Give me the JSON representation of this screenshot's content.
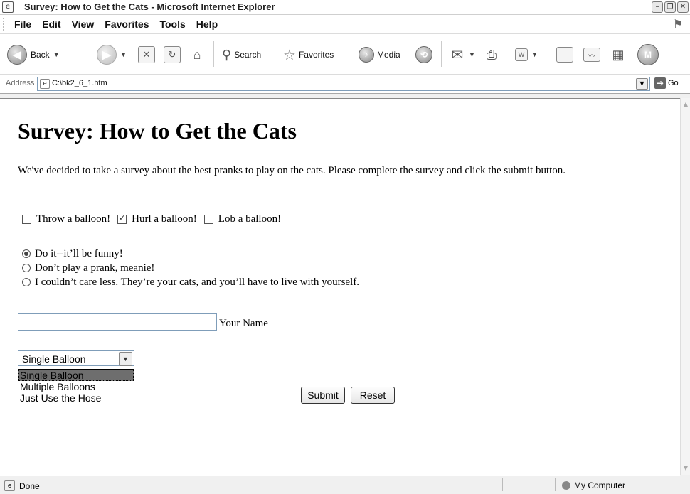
{
  "window": {
    "title": "Survey: How to Get the Cats - Microsoft Internet Explorer"
  },
  "menu": {
    "items": [
      "File",
      "Edit",
      "View",
      "Favorites",
      "Tools",
      "Help"
    ]
  },
  "toolbar": {
    "back_label": "Back",
    "search_label": "Search",
    "favorites_label": "Favorites",
    "media_label": "Media"
  },
  "address": {
    "label": "Address",
    "url": "C:\\bk2_6_1.htm",
    "go_label": "Go"
  },
  "page": {
    "title": "Survey: How to Get the Cats",
    "intro": "We've decided to take a survey about the best pranks to play on the cats. Please complete the survey and click the submit button.",
    "checkboxes": [
      {
        "label": "Throw a balloon!",
        "checked": false
      },
      {
        "label": "Hurl a balloon!",
        "checked": true
      },
      {
        "label": "Lob a balloon!",
        "checked": false
      }
    ],
    "radios": [
      {
        "label": "Do it--it’ll be funny!",
        "selected": true
      },
      {
        "label": "Don’t play a prank, meanie!",
        "selected": false
      },
      {
        "label": "I couldn’t care less. They’re your cats, and you’ll have to live with yourself.",
        "selected": false
      }
    ],
    "name_input": {
      "value": "",
      "label": "Your Name"
    },
    "select": {
      "value": "Single Balloon",
      "options": [
        "Single Balloon",
        "Multiple Balloons",
        "Just Use the Hose"
      ]
    },
    "submit_label": "Submit",
    "reset_label": "Reset"
  },
  "status": {
    "text": "Done",
    "zone": "My Computer"
  }
}
